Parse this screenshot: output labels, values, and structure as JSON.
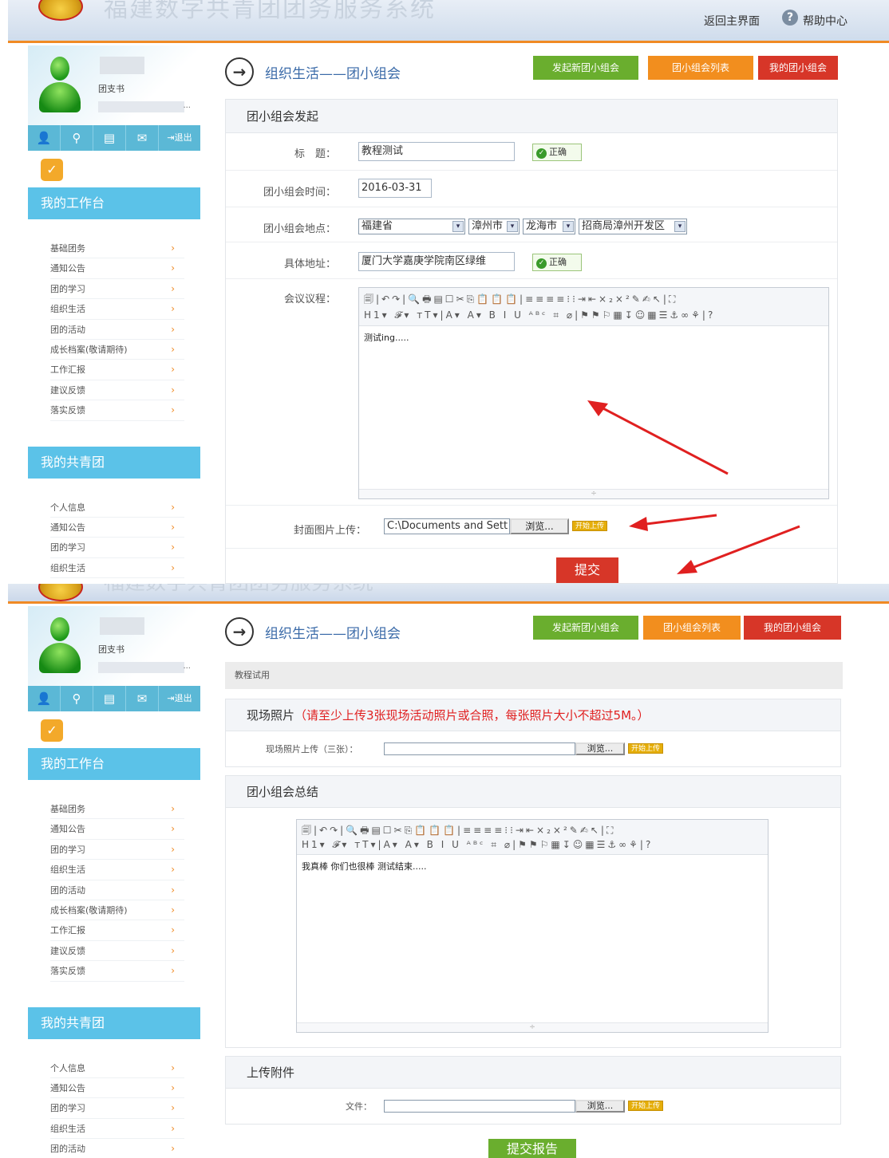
{
  "header": {
    "faded_title": "福建数字共青团团务服务系统",
    "back_link": "返回主界面",
    "help_link": "帮助中心"
  },
  "sidebar": {
    "role": "团支书",
    "truncation": "...",
    "logout": "退出",
    "workbench_title": "我的工作台",
    "workbench_items": [
      "基础团务",
      "通知公告",
      "团的学习",
      "组织生活",
      "团的活动",
      "成长档案(敬请期待)",
      "工作汇报",
      "建议反馈",
      "落实反馈"
    ],
    "league_title": "我的共青团",
    "league_items_top": [
      "个人信息",
      "通知公告",
      "团的学习",
      "组织生活"
    ],
    "league_items_bottom": [
      "个人信息",
      "通知公告",
      "团的学习",
      "组织生活",
      "团的活动"
    ],
    "arrow": "›"
  },
  "page": {
    "title": "组织生活——团小组会",
    "btn_new": "发起新团小组会",
    "btn_list": "团小组会列表",
    "btn_mine": "我的团小组会"
  },
  "form": {
    "section_title": "团小组会发起",
    "title_label": "标　题：",
    "title_value": "教程测试",
    "ok_text": "正确",
    "time_label": "团小组会时间：",
    "time_value": "2016-03-31",
    "place_label": "团小组会地点：",
    "province": "福建省",
    "city": "漳州市",
    "county": "龙海市",
    "district": "招商局漳州开发区",
    "address_label": "具体地址：",
    "address_value": "厦门大学嘉庚学院南区绿维",
    "agenda_label": "会议议程：",
    "agenda_content": "测试ing.....",
    "cover_label": "封面图片上传：",
    "cover_path": "C:\\Documents and Sett",
    "browse": "浏览...",
    "upload": "开始上传",
    "submit": "提交"
  },
  "report": {
    "meeting_name": "教程试用",
    "photos_title": "现场照片",
    "photos_note": "（请至少上传3张现场活动照片或合照，每张照片大小不超过5M。）",
    "photos_label": "现场照片上传（三张）：",
    "summary_title": "团小组会总结",
    "summary_content": "我真棒 你们也很棒 测试结束.....",
    "attach_title": "上传附件",
    "file_label": "文件：",
    "browse": "浏览...",
    "upload": "开始上传",
    "submit": "提交报告"
  },
  "editor": {
    "row1": "🗐|↶↷|🔍🖶▤☐✂⎘📋📋📋|≡≡≡≡⁝⁝⇥⇤×₂×²✎✍↖|⛶",
    "row2": "H1▾ 𝓕▾ тT▾|A▾ A▾ B I U ᴬᴮᶜ ⌗ ⌀|⚑⚑⚐▦↧☺▦☰⚓∞⚘|?",
    "resize": "÷"
  },
  "colors": {
    "accent_orange": "#f08a24",
    "sidebar_blue": "#5bc2e8",
    "btn_green": "#6aae2e",
    "btn_orange": "#f28e1e",
    "btn_red": "#d73628",
    "annotation_red": "#e02020"
  }
}
